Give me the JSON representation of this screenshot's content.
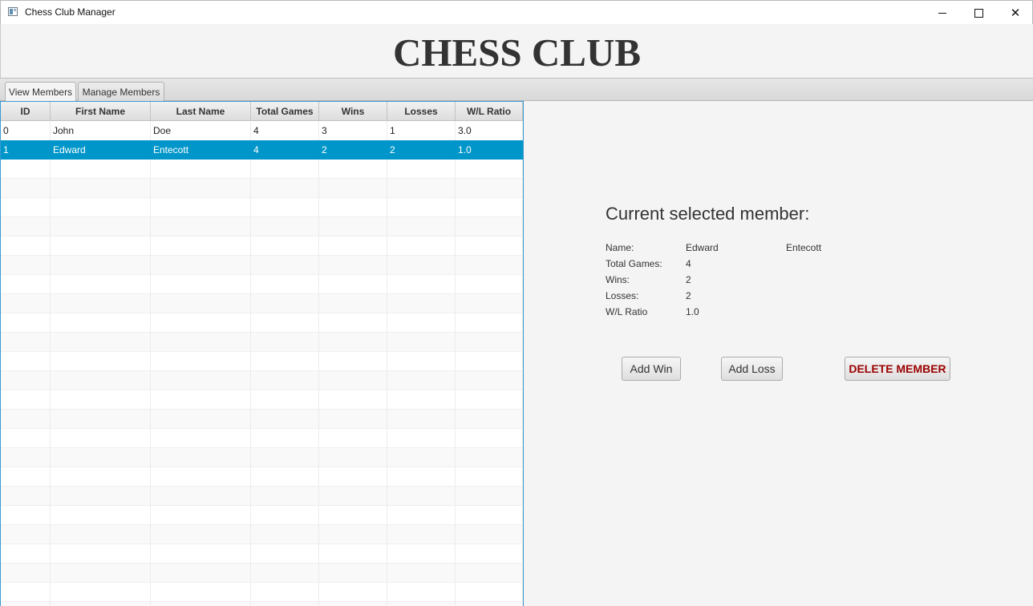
{
  "window": {
    "title": "Chess Club Manager",
    "minimize_glyph": "",
    "close_glyph": "✕"
  },
  "header": {
    "title": "CHESS CLUB"
  },
  "tabs": [
    {
      "label": "View Members",
      "active": true
    },
    {
      "label": "Manage Members",
      "active": false
    }
  ],
  "table": {
    "columns": [
      "ID",
      "First Name",
      "Last Name",
      "Total Games",
      "Wins",
      "Losses",
      "W/L Ratio"
    ],
    "rows": [
      {
        "id": "0",
        "first": "John",
        "last": "Doe",
        "total": "4",
        "wins": "3",
        "losses": "1",
        "ratio": "3.0"
      },
      {
        "id": "1",
        "first": "Edward",
        "last": "Entecott",
        "total": "4",
        "wins": "2",
        "losses": "2",
        "ratio": "1.0",
        "selected": true
      }
    ]
  },
  "detail": {
    "heading": "Current selected member:",
    "name_label": "Name:",
    "first_name": "Edward",
    "last_name": "Entecott",
    "total_label": "Total Games:",
    "total": "4",
    "wins_label": "Wins:",
    "wins": "2",
    "losses_label": "Losses:",
    "losses": "2",
    "ratio_label": "W/L Ratio",
    "ratio": "1.0"
  },
  "actions": {
    "add_win": "Add Win",
    "add_loss": "Add Loss",
    "delete": "DELETE MEMBER"
  },
  "colors": {
    "selection": "#0096c9",
    "delete_text": "#9c0000",
    "table_border": "#3c9bd1"
  }
}
